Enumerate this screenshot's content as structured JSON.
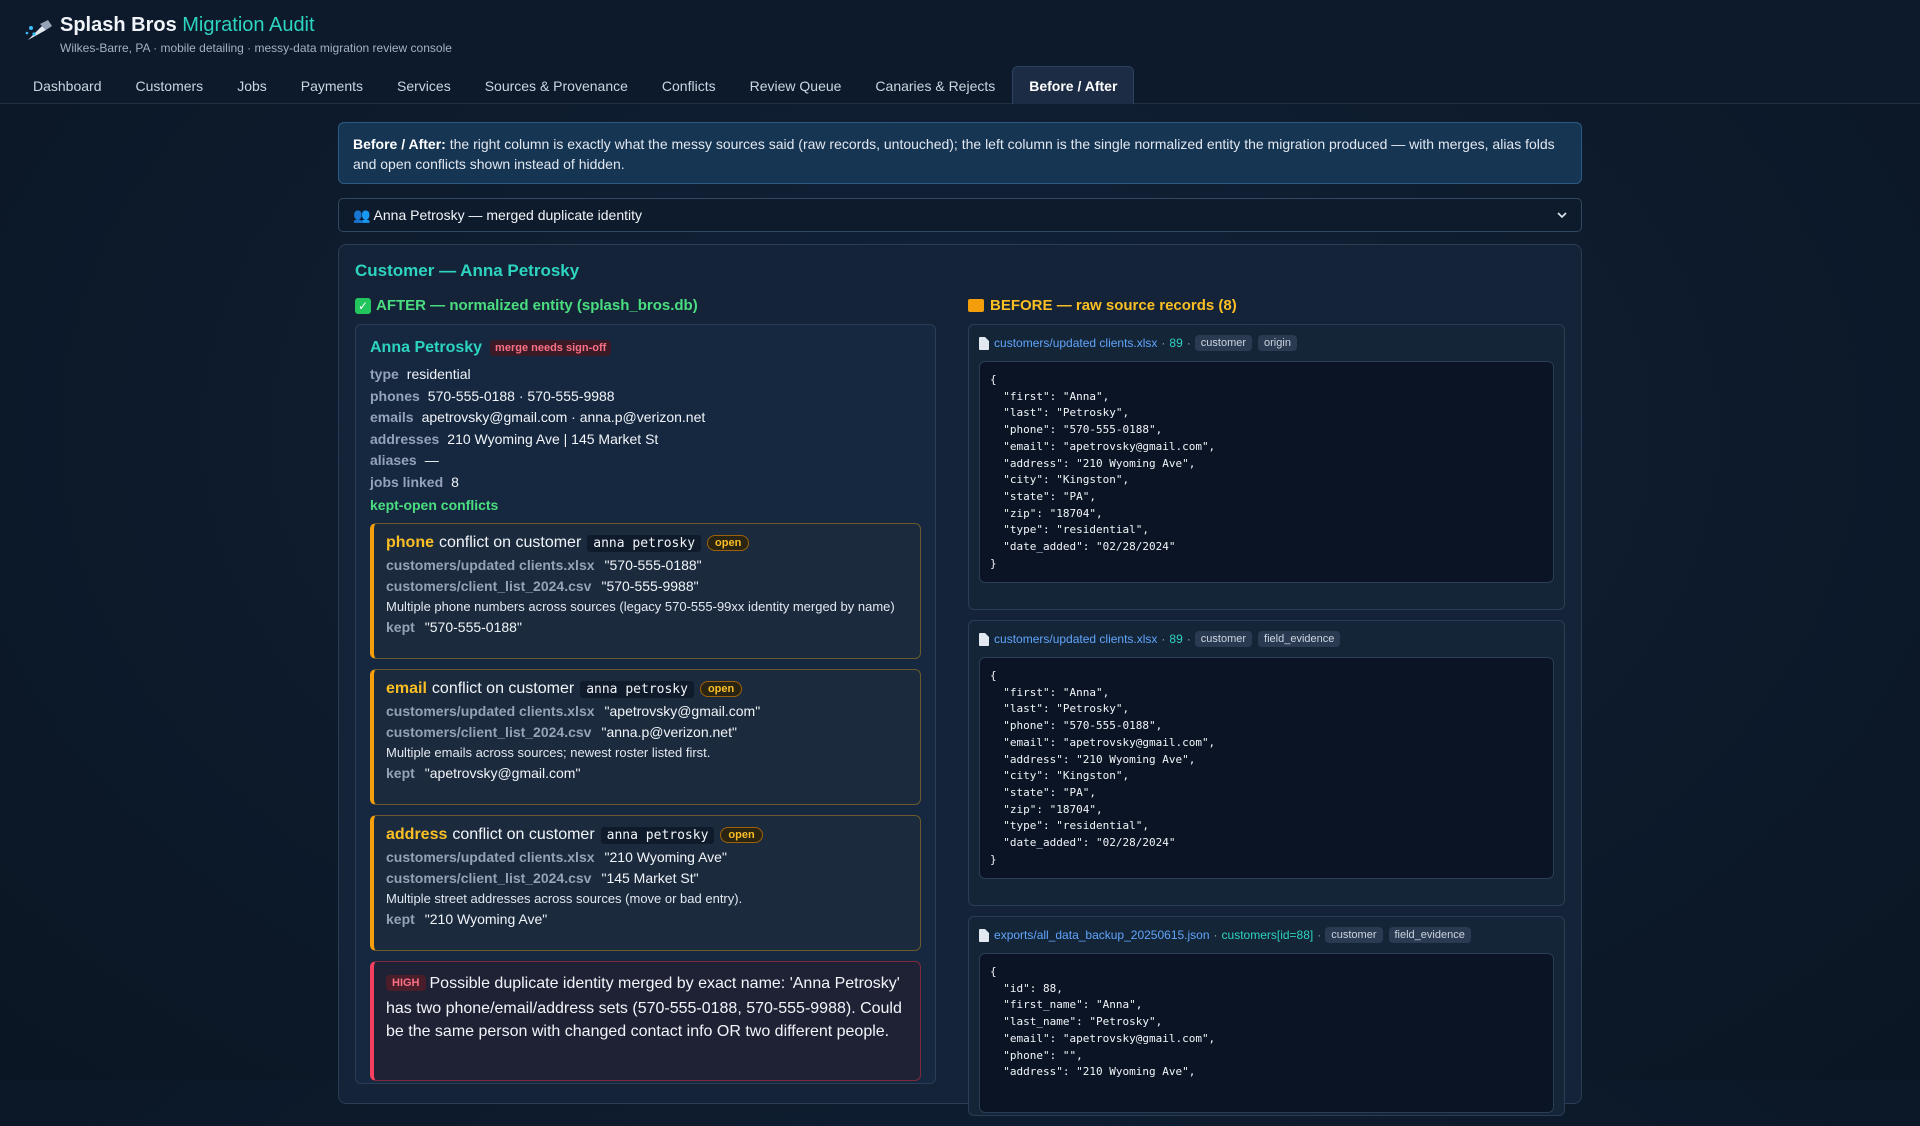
{
  "app": {
    "title_main": "Splash Bros",
    "title_accent": "Migration Audit",
    "subtitle": "Wilkes-Barre, PA · mobile detailing · messy-data migration review console"
  },
  "nav": {
    "tabs": [
      "Dashboard",
      "Customers",
      "Jobs",
      "Payments",
      "Services",
      "Sources & Provenance",
      "Conflicts",
      "Review Queue",
      "Canaries & Rejects",
      "Before / After"
    ],
    "active": "Before / After"
  },
  "banner": {
    "bold": "Before / After:",
    "text": " the right column is exactly what the messy sources said (raw records, untouched); the left column is the single normalized entity the migration produced — with merges, alias folds and open conflicts shown instead of hidden."
  },
  "selector": {
    "value": "👥 Anna Petrosky — merged duplicate identity"
  },
  "panel": {
    "title": "Customer — Anna Petrosky",
    "after_heading": "AFTER — normalized entity (splash_bros.db)",
    "before_heading": "BEFORE — raw source records (8)"
  },
  "entity": {
    "name": "Anna Petrosky",
    "badge": "merge needs sign-off",
    "fields": {
      "type": {
        "k": "type",
        "v": "residential"
      },
      "phones": {
        "k": "phones",
        "v": "570-555-0188 · 570-555-9988"
      },
      "emails": {
        "k": "emails",
        "v": "apetrovsky@gmail.com · anna.p@verizon.net"
      },
      "addresses": {
        "k": "addresses",
        "v": "210 Wyoming Ave | 145 Market St"
      },
      "aliases": {
        "k": "aliases",
        "v": "—"
      },
      "jobs": {
        "k": "jobs linked",
        "v": "8"
      }
    },
    "kept_open_label": "kept-open conflicts",
    "conflict_mid": "conflict on customer",
    "kept_label": "kept",
    "conflicts": [
      {
        "field": "phone",
        "entity": "anna petrosky",
        "status": "open",
        "src1": "customers/updated clients.xlsx",
        "val1": "\"570-555-0188\"",
        "src2": "customers/client_list_2024.csv",
        "val2": "\"570-555-9988\"",
        "note": "Multiple phone numbers across sources (legacy 570-555-99xx identity merged by name)",
        "kept": "\"570-555-0188\""
      },
      {
        "field": "email",
        "entity": "anna petrosky",
        "status": "open",
        "src1": "customers/updated clients.xlsx",
        "val1": "\"apetrovsky@gmail.com\"",
        "src2": "customers/client_list_2024.csv",
        "val2": "\"anna.p@verizon.net\"",
        "note": "Multiple emails across sources; newest roster listed first.",
        "kept": "\"apetrovsky@gmail.com\""
      },
      {
        "field": "address",
        "entity": "anna petrosky",
        "status": "open",
        "src1": "customers/updated clients.xlsx",
        "val1": "\"210 Wyoming Ave\"",
        "src2": "customers/client_list_2024.csv",
        "val2": "\"145 Market St\"",
        "note": "Multiple street addresses across sources (move or bad entry).",
        "kept": "\"210 Wyoming Ave\""
      }
    ],
    "high": {
      "label": "HIGH",
      "text": "Possible duplicate identity merged by exact name: 'Anna Petrosky' has two phone/email/address sets (570-555-0188, 570-555-9988). Could be the same person with changed contact info OR two different people."
    }
  },
  "records": [
    {
      "src": "customers/updated clients.xlsx",
      "ref": "89",
      "tags": [
        "customer",
        "origin"
      ],
      "json": "{\n  \"first\": \"Anna\",\n  \"last\": \"Petrosky\",\n  \"phone\": \"570-555-0188\",\n  \"email\": \"apetrovsky@gmail.com\",\n  \"address\": \"210 Wyoming Ave\",\n  \"city\": \"Kingston\",\n  \"state\": \"PA\",\n  \"zip\": \"18704\",\n  \"type\": \"residential\",\n  \"date_added\": \"02/28/2024\"\n}"
    },
    {
      "src": "customers/updated clients.xlsx",
      "ref": "89",
      "tags": [
        "customer",
        "field_evidence"
      ],
      "json": "{\n  \"first\": \"Anna\",\n  \"last\": \"Petrosky\",\n  \"phone\": \"570-555-0188\",\n  \"email\": \"apetrovsky@gmail.com\",\n  \"address\": \"210 Wyoming Ave\",\n  \"city\": \"Kingston\",\n  \"state\": \"PA\",\n  \"zip\": \"18704\",\n  \"type\": \"residential\",\n  \"date_added\": \"02/28/2024\"\n}"
    },
    {
      "src": "exports/all_data_backup_20250615.json",
      "ref": "customers[id=88]",
      "tags": [
        "customer",
        "field_evidence"
      ],
      "json": "{\n  \"id\": 88,\n  \"first_name\": \"Anna\",\n  \"last_name\": \"Petrosky\",\n  \"email\": \"apetrovsky@gmail.com\",\n  \"phone\": \"\",\n  \"address\": \"210 Wyoming Ave\","
    }
  ]
}
